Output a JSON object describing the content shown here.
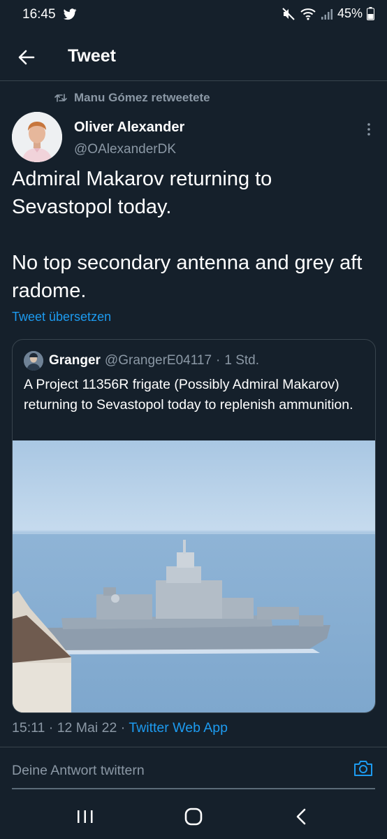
{
  "status": {
    "time": "16:45",
    "battery": "45%"
  },
  "header": {
    "title": "Tweet"
  },
  "retweet": {
    "text": "Manu Gómez retweetete"
  },
  "tweet": {
    "author_name": "Oliver Alexander",
    "author_handle": "@OAlexanderDK",
    "text": "Admiral Makarov returning to Sevastopol today.\n\nNo top secondary antenna and grey aft radome.",
    "translate_label": "Tweet übersetzen"
  },
  "quote": {
    "author_name": "Granger",
    "author_handle": "@GrangerE04117",
    "separator": "·",
    "time": "1 Std.",
    "text": "A Project 11356R frigate (Possibly Admiral Makarov) returning to Sevastopol today to replenish ammunition."
  },
  "meta": {
    "time": "15:11",
    "sep1": "·",
    "date": "12 Mai 22",
    "sep2": "·",
    "source": "Twitter Web App"
  },
  "reply": {
    "placeholder": "Deine Antwort twittern"
  },
  "colors": {
    "background": "#15202b",
    "accent": "#1d9bf0",
    "secondary_text": "#8b98a5",
    "border": "#38444d"
  },
  "icons": {
    "back": "arrow-left-icon",
    "retweet": "retweet-icon",
    "more": "more-vertical-icon",
    "camera": "camera-icon",
    "nav_recent": "recent-apps-icon",
    "nav_home": "home-icon",
    "nav_back": "chevron-left-icon"
  }
}
